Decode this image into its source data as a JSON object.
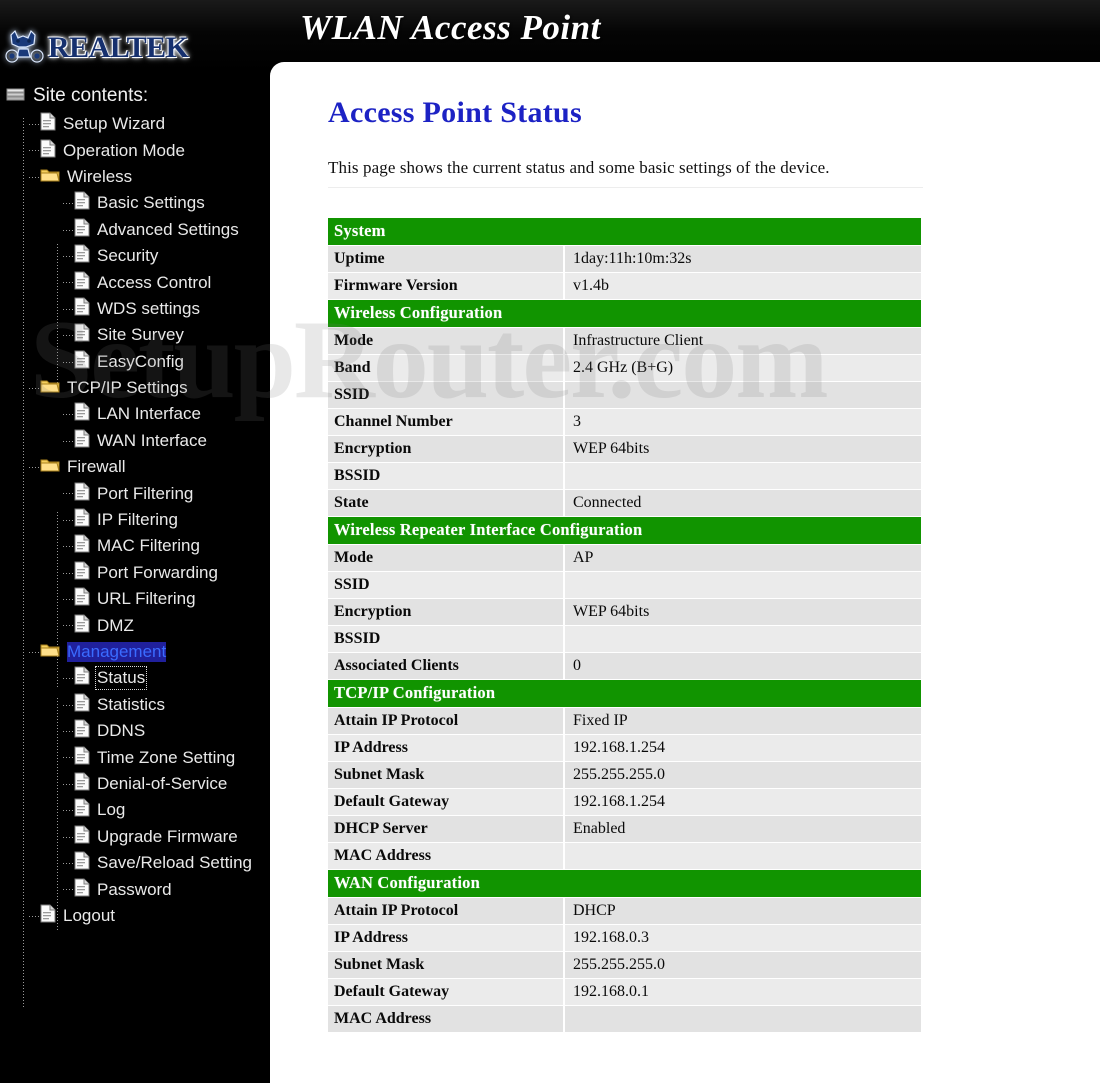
{
  "banner": {
    "title": "WLAN Access Point",
    "logo_text": "REALTEK",
    "logo_icon": "realtek-mascot-icon"
  },
  "watermark": {
    "text": "SetupRouter.com"
  },
  "sidebar": {
    "root_label": "Site contents:",
    "root_icon": "site-contents-icon",
    "items": [
      {
        "label": "Setup Wizard",
        "level": 1,
        "icon": "page-icon",
        "state": "normal"
      },
      {
        "label": "Operation Mode",
        "level": 1,
        "icon": "page-icon",
        "state": "normal"
      },
      {
        "label": "Wireless",
        "level": 1,
        "icon": "folder-icon",
        "state": "normal"
      },
      {
        "label": "Basic Settings",
        "level": 2,
        "icon": "page-icon",
        "state": "normal"
      },
      {
        "label": "Advanced Settings",
        "level": 2,
        "icon": "page-icon",
        "state": "normal"
      },
      {
        "label": "Security",
        "level": 2,
        "icon": "page-icon",
        "state": "normal"
      },
      {
        "label": "Access Control",
        "level": 2,
        "icon": "page-icon",
        "state": "normal"
      },
      {
        "label": "WDS settings",
        "level": 2,
        "icon": "page-icon",
        "state": "normal"
      },
      {
        "label": "Site Survey",
        "level": 2,
        "icon": "page-icon",
        "state": "normal"
      },
      {
        "label": "EasyConfig",
        "level": 2,
        "icon": "page-icon",
        "state": "normal"
      },
      {
        "label": "TCP/IP Settings",
        "level": 1,
        "icon": "folder-icon",
        "state": "normal"
      },
      {
        "label": "LAN Interface",
        "level": 2,
        "icon": "page-icon",
        "state": "normal"
      },
      {
        "label": "WAN Interface",
        "level": 2,
        "icon": "page-icon",
        "state": "normal"
      },
      {
        "label": "Firewall",
        "level": 1,
        "icon": "folder-icon",
        "state": "normal"
      },
      {
        "label": "Port Filtering",
        "level": 2,
        "icon": "page-icon",
        "state": "normal"
      },
      {
        "label": "IP Filtering",
        "level": 2,
        "icon": "page-icon",
        "state": "normal"
      },
      {
        "label": "MAC Filtering",
        "level": 2,
        "icon": "page-icon",
        "state": "normal"
      },
      {
        "label": "Port Forwarding",
        "level": 2,
        "icon": "page-icon",
        "state": "normal"
      },
      {
        "label": "URL Filtering",
        "level": 2,
        "icon": "page-icon",
        "state": "normal"
      },
      {
        "label": "DMZ",
        "level": 2,
        "icon": "page-icon",
        "state": "normal"
      },
      {
        "label": "Management",
        "level": 1,
        "icon": "folder-icon",
        "state": "selected"
      },
      {
        "label": "Status",
        "level": 2,
        "icon": "page-icon",
        "state": "focused"
      },
      {
        "label": "Statistics",
        "level": 2,
        "icon": "page-icon",
        "state": "normal"
      },
      {
        "label": "DDNS",
        "level": 2,
        "icon": "page-icon",
        "state": "normal"
      },
      {
        "label": "Time Zone Setting",
        "level": 2,
        "icon": "page-icon",
        "state": "normal"
      },
      {
        "label": "Denial-of-Service",
        "level": 2,
        "icon": "page-icon",
        "state": "normal"
      },
      {
        "label": "Log",
        "level": 2,
        "icon": "page-icon",
        "state": "normal"
      },
      {
        "label": "Upgrade Firmware",
        "level": 2,
        "icon": "page-icon",
        "state": "normal"
      },
      {
        "label": "Save/Reload Setting",
        "level": 2,
        "icon": "page-icon",
        "state": "normal"
      },
      {
        "label": "Password",
        "level": 2,
        "icon": "page-icon",
        "state": "normal"
      },
      {
        "label": "Logout",
        "level": 1,
        "icon": "page-icon",
        "state": "normal"
      }
    ]
  },
  "main": {
    "title": "Access Point Status",
    "description": "This page shows the current status and some basic settings of the device.",
    "sections": [
      {
        "heading": "System",
        "rows": [
          {
            "key": "Uptime",
            "value": "1day:11h:10m:32s"
          },
          {
            "key": "Firmware Version",
            "value": "v1.4b"
          }
        ]
      },
      {
        "heading": "Wireless Configuration",
        "rows": [
          {
            "key": "Mode",
            "value": "Infrastructure Client"
          },
          {
            "key": "Band",
            "value": "2.4 GHz (B+G)"
          },
          {
            "key": "SSID",
            "value": ""
          },
          {
            "key": "Channel Number",
            "value": "3"
          },
          {
            "key": "Encryption",
            "value": "WEP 64bits"
          },
          {
            "key": "BSSID",
            "value": ""
          },
          {
            "key": "State",
            "value": "Connected"
          }
        ]
      },
      {
        "heading": "Wireless Repeater Interface Configuration",
        "rows": [
          {
            "key": "Mode",
            "value": "AP"
          },
          {
            "key": "SSID",
            "value": ""
          },
          {
            "key": "Encryption",
            "value": "WEP 64bits"
          },
          {
            "key": "BSSID",
            "value": ""
          },
          {
            "key": "Associated Clients",
            "value": "0"
          }
        ]
      },
      {
        "heading": "TCP/IP Configuration",
        "rows": [
          {
            "key": "Attain IP Protocol",
            "value": "Fixed IP"
          },
          {
            "key": "IP Address",
            "value": "192.168.1.254"
          },
          {
            "key": "Subnet Mask",
            "value": "255.255.255.0"
          },
          {
            "key": "Default Gateway",
            "value": "192.168.1.254"
          },
          {
            "key": "DHCP Server",
            "value": "Enabled"
          },
          {
            "key": "MAC Address",
            "value": ""
          }
        ]
      },
      {
        "heading": "WAN Configuration",
        "rows": [
          {
            "key": "Attain IP Protocol",
            "value": "DHCP"
          },
          {
            "key": "IP Address",
            "value": "192.168.0.3"
          },
          {
            "key": "Subnet Mask",
            "value": "255.255.255.0"
          },
          {
            "key": "Default Gateway",
            "value": "192.168.0.1"
          },
          {
            "key": "MAC Address",
            "value": ""
          }
        ]
      }
    ]
  },
  "colors": {
    "section_green": "#119400",
    "title_blue": "#1c22c4",
    "banner_blue": "#1d4b95",
    "row_gray": "#e2e2e2"
  }
}
